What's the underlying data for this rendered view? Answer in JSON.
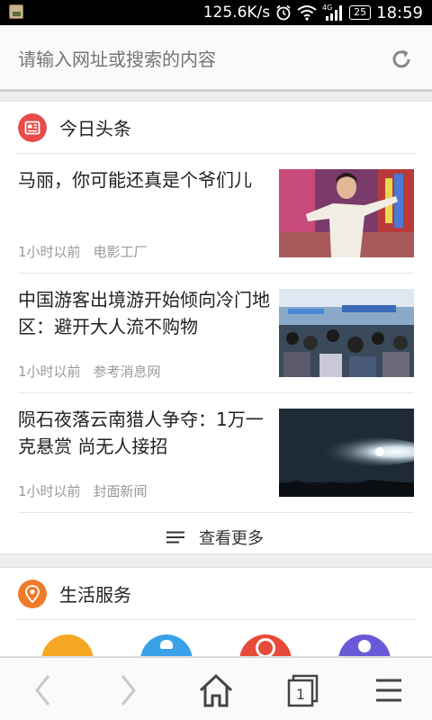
{
  "status_bar": {
    "net_speed": "125.6K/s",
    "network": "4G",
    "battery": "25",
    "time": "18:59"
  },
  "address_bar": {
    "placeholder": "请输入网址或搜索的内容",
    "refresh_icon": "refresh-icon"
  },
  "news": {
    "header": "今日头条",
    "icon": "news-icon",
    "accent": "#e94a4a",
    "items": [
      {
        "title": "马丽，你可能还真是个爷们儿",
        "time": "1小时以前",
        "source": "电影工厂"
      },
      {
        "title": "中国游客出境游开始倾向冷门地区：避开大人流不购物",
        "time": "1小时以前",
        "source": "参考消息网"
      },
      {
        "title": "陨石夜落云南猎人争夺：1万一克悬赏 尚无人接招",
        "time": "1小时以前",
        "source": "封面新闻"
      }
    ],
    "more_label": "查看更多"
  },
  "life": {
    "header": "生活服务",
    "icon": "location-pin-icon",
    "accent": "#f07a2a",
    "service_colors": [
      "#f5a623",
      "#3aa0e8",
      "#e84a3a",
      "#6a5ad8"
    ]
  },
  "bottom_nav": {
    "tab_count": "1",
    "icons": [
      "back-icon",
      "forward-icon",
      "home-icon",
      "tabs-icon",
      "menu-icon"
    ]
  }
}
